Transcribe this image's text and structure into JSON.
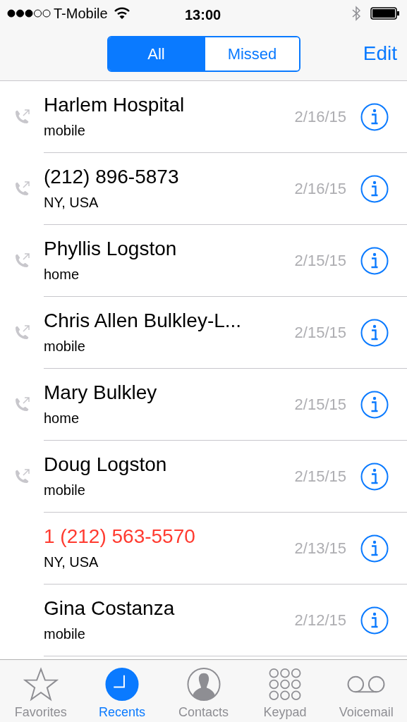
{
  "status_bar": {
    "carrier": "T-Mobile",
    "time": "13:00"
  },
  "segments": [
    {
      "label": "All",
      "selected": true
    },
    {
      "label": "Missed",
      "selected": false
    }
  ],
  "edit": "Edit",
  "calls": [
    {
      "name": "Harlem Hospital",
      "detail": "mobile",
      "date": "2/16/15",
      "kind": "outgoing"
    },
    {
      "name": "(212) 896-5873",
      "detail": "NY, USA",
      "date": "2/16/15",
      "kind": "outgoing"
    },
    {
      "name": "Phyllis Logston",
      "detail": "home",
      "date": "2/15/15",
      "kind": "outgoing"
    },
    {
      "name": "Chris Allen Bulkley-L...",
      "detail": "mobile",
      "date": "2/15/15",
      "kind": "outgoing"
    },
    {
      "name": "Mary Bulkley",
      "detail": "home",
      "date": "2/15/15",
      "kind": "outgoing"
    },
    {
      "name": "Doug Logston",
      "detail": "mobile",
      "date": "2/15/15",
      "kind": "outgoing"
    },
    {
      "name": "1 (212) 563-5570",
      "detail": "NY, USA",
      "date": "2/13/15",
      "kind": "missed"
    },
    {
      "name": "Gina Costanza",
      "detail": "mobile",
      "date": "2/12/15",
      "kind": "incoming"
    }
  ],
  "tabs": [
    {
      "label": "Favorites",
      "kind": "favorites",
      "selected": false
    },
    {
      "label": "Recents",
      "kind": "recents",
      "selected": true
    },
    {
      "label": "Contacts",
      "kind": "contacts",
      "selected": false
    },
    {
      "label": "Keypad",
      "kind": "keypad",
      "selected": false
    },
    {
      "label": "Voicemail",
      "kind": "voicemail",
      "selected": false
    }
  ]
}
